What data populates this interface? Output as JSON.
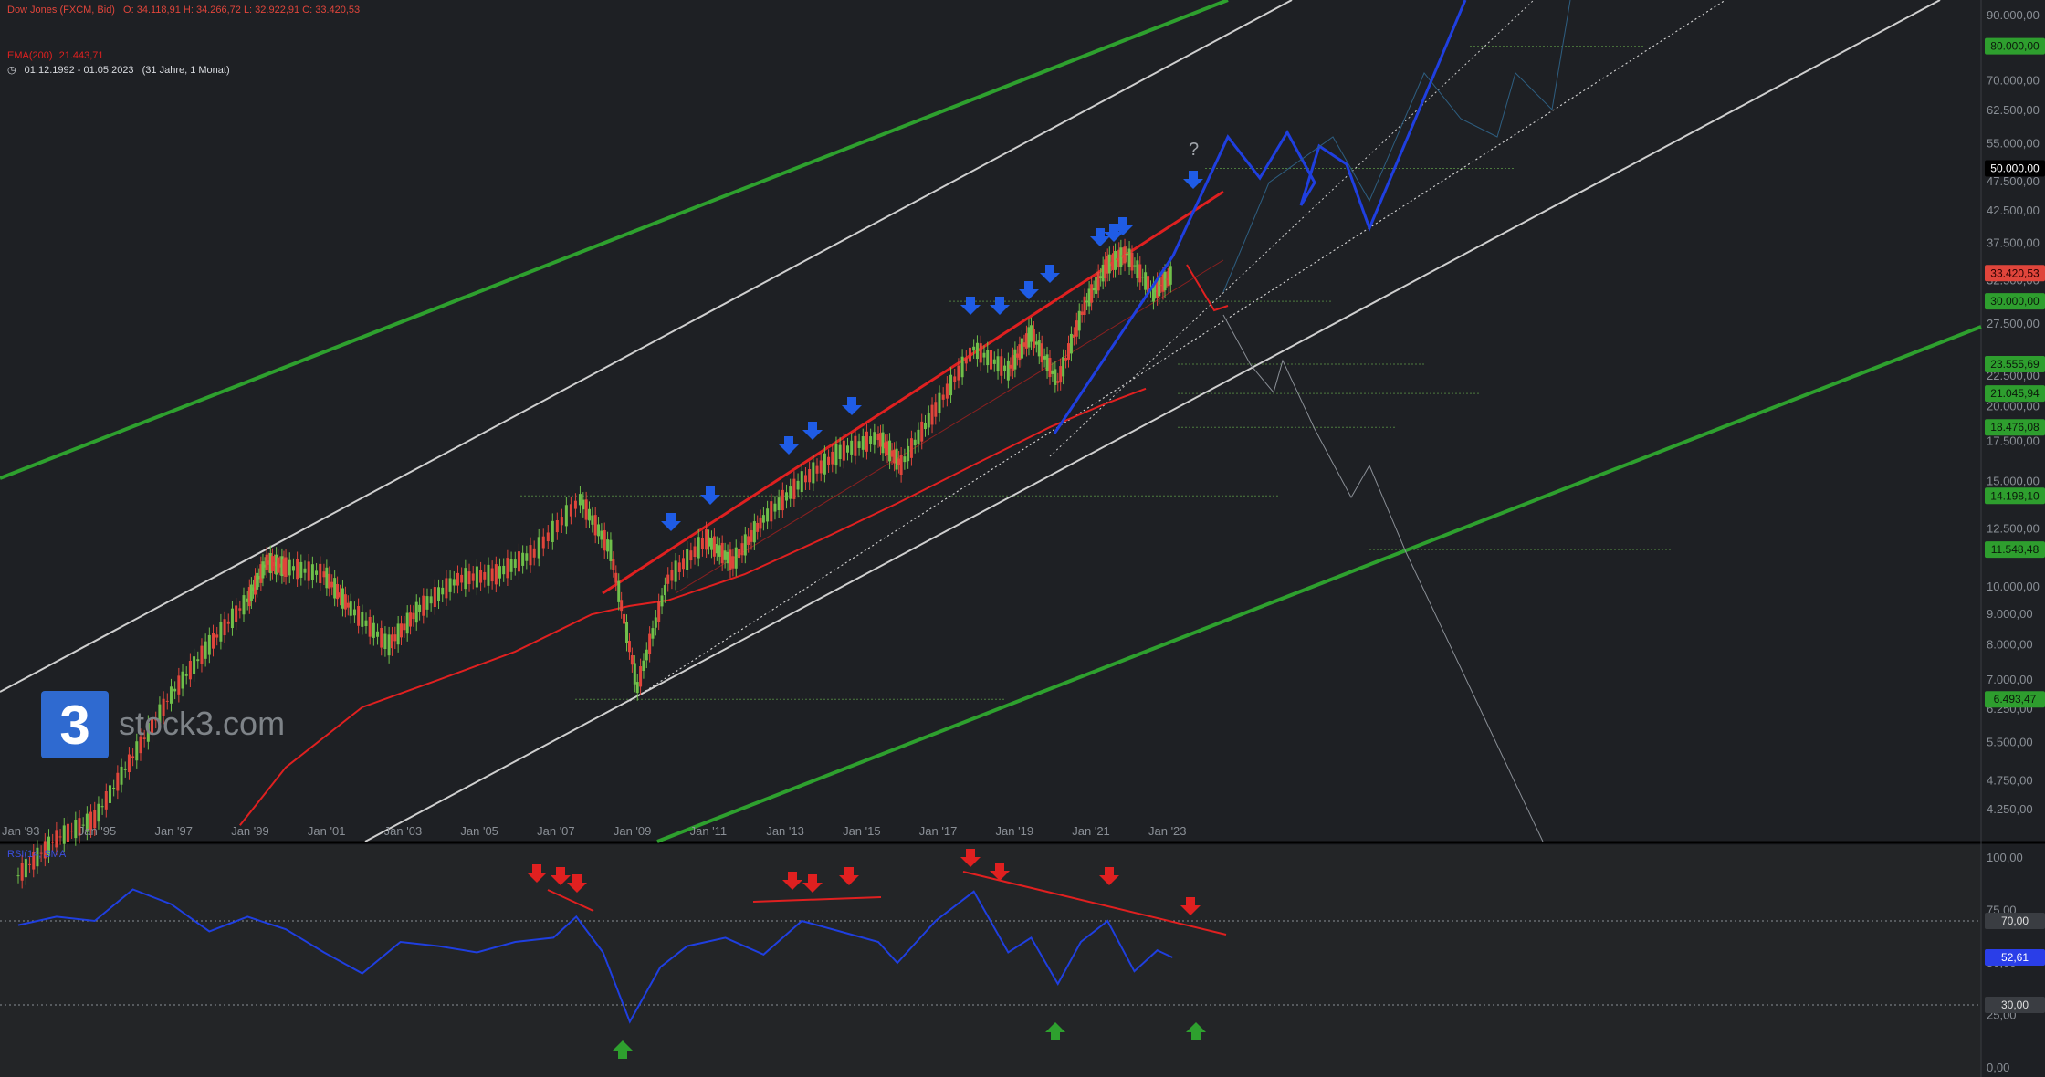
{
  "header": {
    "instrument": "Dow Jones (FXCM, Bid)",
    "ohlc": "O: 34.118,91  H: 34.266,72  L: 32.922,91  C: 33.420,53",
    "ema_label": "EMA(200)",
    "ema_value": "21.443,71",
    "period": "01.12.1992 - 01.05.2023",
    "period_note": "(31 Jahre, 1 Monat)",
    "colors": {
      "instrument": "#e0453b",
      "ema": "#e02020",
      "period": "#d8dadf"
    }
  },
  "logo": {
    "mark": "3",
    "text": "stock3.com",
    "icon": "stock3-logo-icon"
  },
  "oscillator": {
    "label": "RSI(14, SMA",
    "overbought": "70,00",
    "oversold": "30,00",
    "current": "52,61"
  },
  "chart_data": [
    {
      "type": "candlestick",
      "title": "Dow Jones (FXCM, Bid)",
      "scale": "log",
      "ylim": [
        4000,
        95000
      ],
      "x_ticks": [
        "Jan '93",
        "Jan '95",
        "Jan '97",
        "Jan '99",
        "Jan '01",
        "Jan '03",
        "Jan '05",
        "Jan '07",
        "Jan '09",
        "Jan '11",
        "Jan '13",
        "Jan '15",
        "Jan '17",
        "Jan '19",
        "Jan '21",
        "Jan '23"
      ],
      "y_ticks": [
        "90.000,00",
        "80.000,00",
        "70.000,00",
        "62.500,00",
        "55.000,00",
        "47.500,00",
        "42.500,00",
        "37.500,00",
        "32.500,00",
        "27.500,00",
        "22.500,00",
        "20.000,00",
        "17.500,00",
        "15.000,00",
        "12.500,00",
        "10.000,00",
        "9.000,00",
        "8.000,00",
        "7.000,00",
        "6.250,00",
        "5.500,00",
        "4.750,00",
        "4.250,00"
      ],
      "price_tags": [
        {
          "text": "80.000,00",
          "kind": "level",
          "value": 80000
        },
        {
          "text": "50.000,00",
          "kind": "target",
          "value": 50000
        },
        {
          "text": "33.420,53",
          "kind": "last",
          "value": 33420.53
        },
        {
          "text": "30.000,00",
          "kind": "level",
          "value": 30000
        },
        {
          "text": "23.555,69",
          "kind": "level",
          "value": 23555.69
        },
        {
          "text": "21.045,94",
          "kind": "level",
          "value": 21045.94
        },
        {
          "text": "18.476,08",
          "kind": "level",
          "value": 18476.08
        },
        {
          "text": "14.198,10",
          "kind": "level",
          "value": 14198.1
        },
        {
          "text": "11.548,48",
          "kind": "level",
          "value": 11548.48
        },
        {
          "text": "6.493,47",
          "kind": "level",
          "value": 6493.47
        }
      ],
      "series": [
        {
          "name": "Dow Jones (FXCM, Bid)",
          "x": [
            1993.0,
            1994.0,
            1995.0,
            1996.0,
            1997.0,
            1998.0,
            1999.0,
            1999.5,
            2000.0,
            2001.0,
            2001.7,
            2002.7,
            2003.5,
            2004.5,
            2005.5,
            2006.5,
            2007.7,
            2008.5,
            2009.2,
            2010.0,
            2011.0,
            2011.7,
            2012.5,
            2013.5,
            2014.5,
            2015.5,
            2016.1,
            2017.0,
            2018.0,
            2018.9,
            2019.5,
            2020.2,
            2020.9,
            2021.5,
            2022.0,
            2022.7,
            2023.2
          ],
          "values": [
            3300,
            3800,
            4100,
            5200,
            6600,
            8000,
            9500,
            11000,
            10800,
            10500,
            9200,
            8000,
            9200,
            10300,
            10500,
            11400,
            14000,
            11500,
            6800,
            10300,
            12000,
            11000,
            13000,
            15000,
            16800,
            17800,
            16000,
            19800,
            25000,
            23000,
            26500,
            22000,
            29500,
            34500,
            36000,
            31000,
            33400
          ]
        },
        {
          "name": "EMA(200)",
          "x": [
            1998.8,
            2000,
            2002,
            2004,
            2006,
            2008,
            2009,
            2010,
            2012,
            2014,
            2016,
            2018,
            2020,
            2021.5,
            2022.5
          ],
          "values": [
            4000,
            5000,
            6300,
            7000,
            7800,
            9000,
            9300,
            9500,
            10500,
            12000,
            13800,
            16000,
            18500,
            20300,
            21443.71
          ]
        }
      ]
    },
    {
      "type": "line",
      "title": "RSI(14, SMA",
      "ylim": [
        0,
        100
      ],
      "y_ticks": [
        "100,00",
        "75,00",
        "50,00",
        "25,00",
        "0,00"
      ],
      "levels": [
        70,
        30
      ],
      "series": [
        {
          "name": "RSI",
          "x": [
            1993,
            1994,
            1995,
            1996,
            1997,
            1998,
            1999,
            2000,
            2001,
            2002,
            2003,
            2004,
            2005,
            2006,
            2007,
            2007.6,
            2008.3,
            2009.0,
            2009.8,
            2010.5,
            2011.5,
            2012.5,
            2013.5,
            2014.5,
            2015.5,
            2016,
            2017,
            2018,
            2018.9,
            2019.5,
            2020.2,
            2020.8,
            2021.5,
            2022.2,
            2022.8,
            2023.2
          ],
          "values": [
            68,
            72,
            70,
            85,
            78,
            65,
            72,
            66,
            55,
            45,
            60,
            58,
            55,
            60,
            62,
            72,
            55,
            22,
            48,
            58,
            62,
            54,
            70,
            65,
            60,
            50,
            70,
            84,
            55,
            62,
            40,
            60,
            70,
            46,
            56,
            52.61
          ]
        }
      ]
    }
  ]
}
